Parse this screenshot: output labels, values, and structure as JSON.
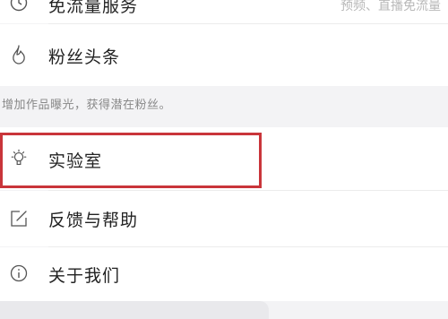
{
  "menu": {
    "items": [
      {
        "id": "free-traffic",
        "label": "免流量服务",
        "right_text": "预频、直播免流量",
        "icon": "clock-icon"
      },
      {
        "id": "fans-headline",
        "label": "粉丝头条",
        "icon": "flame-icon"
      },
      {
        "id": "lab",
        "label": "实验室",
        "icon": "lightbulb-icon"
      },
      {
        "id": "feedback-help",
        "label": "反馈与帮助",
        "icon": "edit-icon"
      },
      {
        "id": "about-us",
        "label": "关于我们",
        "icon": "info-icon"
      }
    ],
    "fans_hint": "增加作品曝光，获得潜在粉丝。"
  },
  "colors": {
    "highlight_border": "#c9353a",
    "background": "#f3f3f5",
    "row_background": "#ffffff"
  }
}
